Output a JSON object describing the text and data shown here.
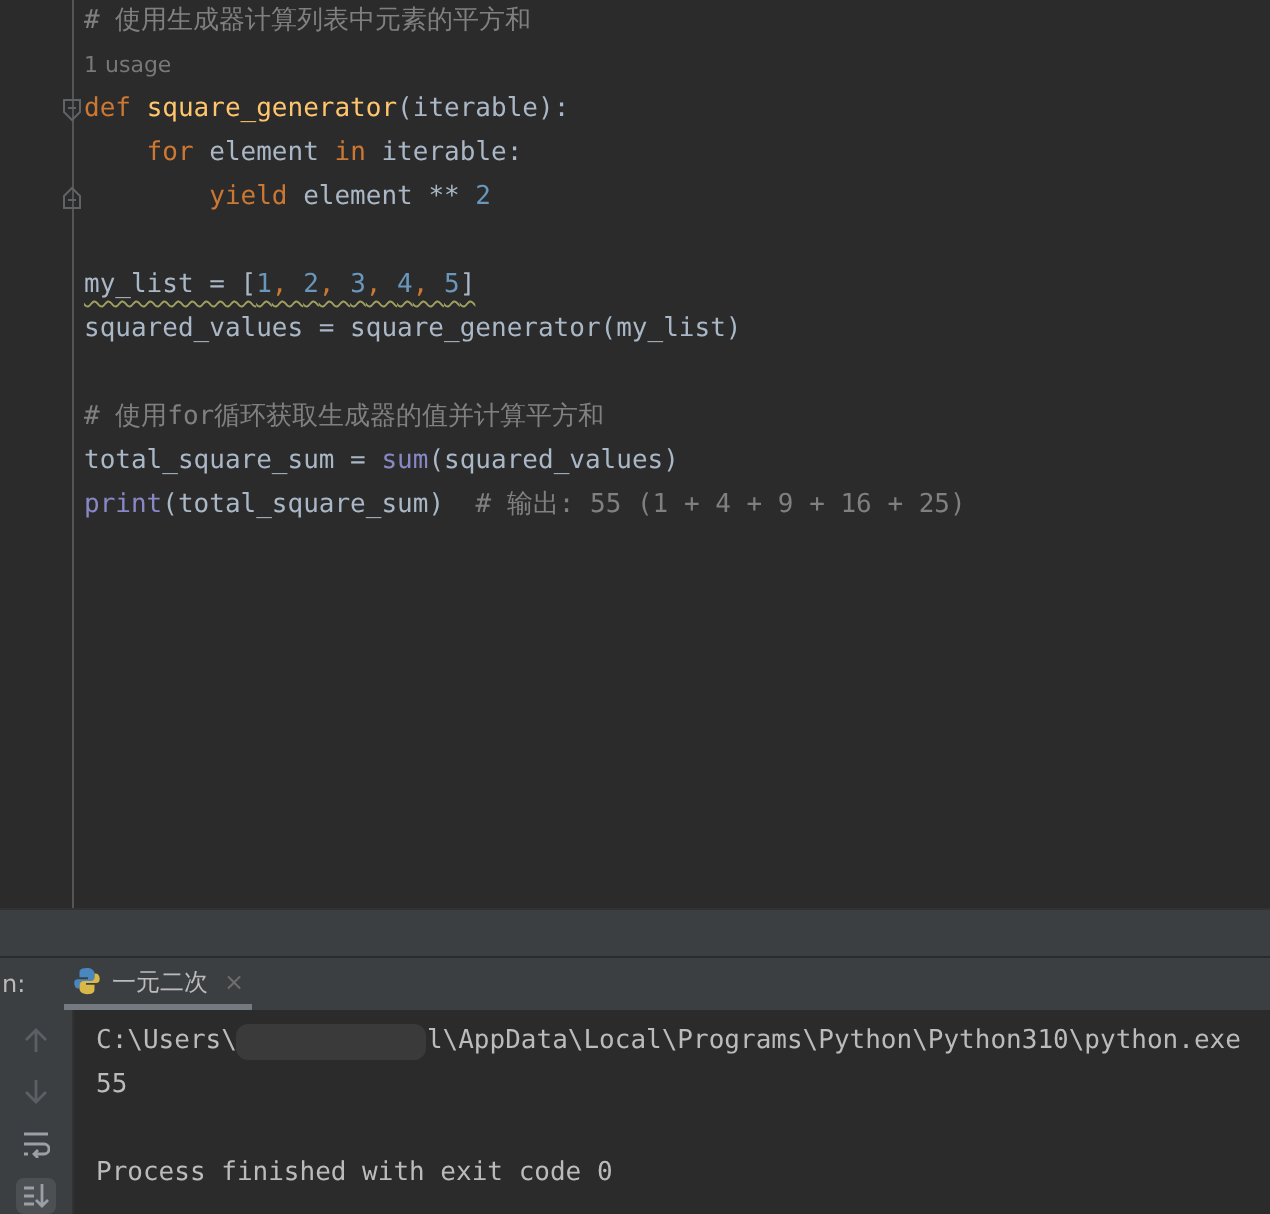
{
  "editor": {
    "lines": [
      {
        "kind": "code",
        "tokens": [
          {
            "t": "# 使用生成器计算列表中元素的平方和",
            "kind": "comment"
          }
        ]
      },
      {
        "kind": "hint",
        "text": "1 usage"
      },
      {
        "kind": "code",
        "fold_start": true,
        "tokens": [
          {
            "t": "def ",
            "kind": "keyword"
          },
          {
            "t": "square_generator",
            "kind": "function"
          },
          {
            "t": "(iterable):",
            "kind": "plain"
          }
        ]
      },
      {
        "kind": "code",
        "tokens": [
          {
            "t": "    for ",
            "kind": "keyword"
          },
          {
            "t": "element ",
            "kind": "plain"
          },
          {
            "t": "in ",
            "kind": "keyword"
          },
          {
            "t": "iterable:",
            "kind": "plain"
          }
        ]
      },
      {
        "kind": "code",
        "fold_end": true,
        "tokens": [
          {
            "t": "        yield ",
            "kind": "keyword"
          },
          {
            "t": "element ** ",
            "kind": "plain"
          },
          {
            "t": "2",
            "kind": "number"
          }
        ]
      },
      {
        "kind": "blank"
      },
      {
        "kind": "code",
        "warning": true,
        "tokens": [
          {
            "t": "my_list = [",
            "kind": "plain"
          },
          {
            "t": "1",
            "kind": "number"
          },
          {
            "t": ", ",
            "kind": "keyword"
          },
          {
            "t": "2",
            "kind": "number"
          },
          {
            "t": ", ",
            "kind": "keyword"
          },
          {
            "t": "3",
            "kind": "number"
          },
          {
            "t": ", ",
            "kind": "keyword"
          },
          {
            "t": "4",
            "kind": "number"
          },
          {
            "t": ", ",
            "kind": "keyword"
          },
          {
            "t": "5",
            "kind": "number"
          },
          {
            "t": "]",
            "kind": "plain"
          }
        ]
      },
      {
        "kind": "code",
        "tokens": [
          {
            "t": "squared_values = square_generator(my_list)",
            "kind": "plain"
          }
        ]
      },
      {
        "kind": "blank"
      },
      {
        "kind": "code",
        "tokens": [
          {
            "t": "# 使用for循环获取生成器的值并计算平方和",
            "kind": "comment"
          }
        ]
      },
      {
        "kind": "code",
        "tokens": [
          {
            "t": "total_square_sum = ",
            "kind": "plain"
          },
          {
            "t": "sum",
            "kind": "builtin"
          },
          {
            "t": "(squared_values)",
            "kind": "plain"
          }
        ]
      },
      {
        "kind": "code",
        "tokens": [
          {
            "t": "print",
            "kind": "builtin"
          },
          {
            "t": "(total_square_sum)  ",
            "kind": "plain"
          },
          {
            "t": "# 输出: 55 (1 + 4 + 9 + 16 + 25)",
            "kind": "comment"
          }
        ]
      }
    ]
  },
  "run_panel": {
    "label": "n:",
    "tabs": [
      {
        "label": "一元二次",
        "selected": true,
        "close": "×"
      }
    ],
    "toolbar": [
      {
        "kind": "up",
        "selected": false
      },
      {
        "kind": "down",
        "selected": false
      },
      {
        "kind": "wrap",
        "selected": false
      },
      {
        "kind": "scroll",
        "selected": true
      }
    ],
    "console": [
      {
        "kind": "redacted",
        "before": "C:\\Users\\",
        "after": "l\\AppData\\Local\\Programs\\Python\\Python310\\python.exe"
      },
      {
        "kind": "text",
        "text": "55"
      },
      {
        "kind": "blank"
      },
      {
        "kind": "text",
        "text": "Process finished with exit code 0"
      }
    ]
  }
}
